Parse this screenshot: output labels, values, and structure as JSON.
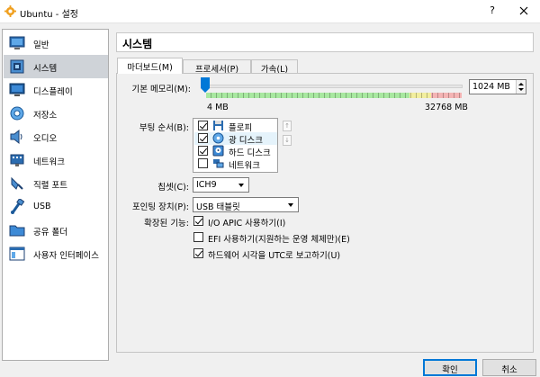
{
  "window": {
    "title": "Ubuntu - 설정",
    "help_label": "?"
  },
  "sidebar": {
    "items": [
      {
        "label": "일반",
        "icon": "general-icon"
      },
      {
        "label": "시스템",
        "icon": "motherboard-icon",
        "selected": true
      },
      {
        "label": "디스플레이",
        "icon": "monitor-icon"
      },
      {
        "label": "저장소",
        "icon": "storage-icon"
      },
      {
        "label": "오디오",
        "icon": "speaker-icon"
      },
      {
        "label": "네트워크",
        "icon": "network-icon"
      },
      {
        "label": "직렬 포트",
        "icon": "serial-port-icon"
      },
      {
        "label": "USB",
        "icon": "usb-icon"
      },
      {
        "label": "공유 폴더",
        "icon": "folder-icon"
      },
      {
        "label": "사용자 인터페이스",
        "icon": "user-interface-icon"
      }
    ]
  },
  "page": {
    "title": "시스템"
  },
  "tabs": [
    {
      "label": "마더보드(M)",
      "active": true
    },
    {
      "label": "프로세서(P)",
      "active": false
    },
    {
      "label": "가속(L)",
      "active": false
    }
  ],
  "memory": {
    "label": "기본 메모리(M):",
    "value": "1024 MB",
    "value_mb": 1024,
    "min_label": "4 MB",
    "max_label": "32768 MB",
    "min_mb": 4,
    "max_mb": 32768
  },
  "boot": {
    "label": "부팅 순서(B):",
    "items": [
      {
        "label": "플로피",
        "checked": true,
        "icon": "floppy-icon"
      },
      {
        "label": "광 디스크",
        "checked": true,
        "icon": "optical-disc-icon",
        "selected": true
      },
      {
        "label": "하드 디스크",
        "checked": true,
        "icon": "hard-disk-icon"
      },
      {
        "label": "네트워크",
        "checked": false,
        "icon": "network-boot-icon"
      }
    ],
    "move_up": "↑",
    "move_down": "↓"
  },
  "chipset": {
    "label": "칩셋(C):",
    "value": "ICH9"
  },
  "pointing": {
    "label": "포인팅 장치(P):",
    "value": "USB 태블릿"
  },
  "extended": {
    "label": "확장된 기능:",
    "options": [
      {
        "label": "I/O APIC 사용하기(I)",
        "checked": true
      },
      {
        "label": "EFI 사용하기(지원하는 운영 체제만)(E)",
        "checked": false
      },
      {
        "label": "하드웨어 시각을 UTC로 보고하기(U)",
        "checked": true
      }
    ]
  },
  "buttons": {
    "ok": "확인",
    "cancel": "취소"
  },
  "colors": {
    "accent": "#0078d7",
    "selected_bg": "#cfd3d8"
  }
}
